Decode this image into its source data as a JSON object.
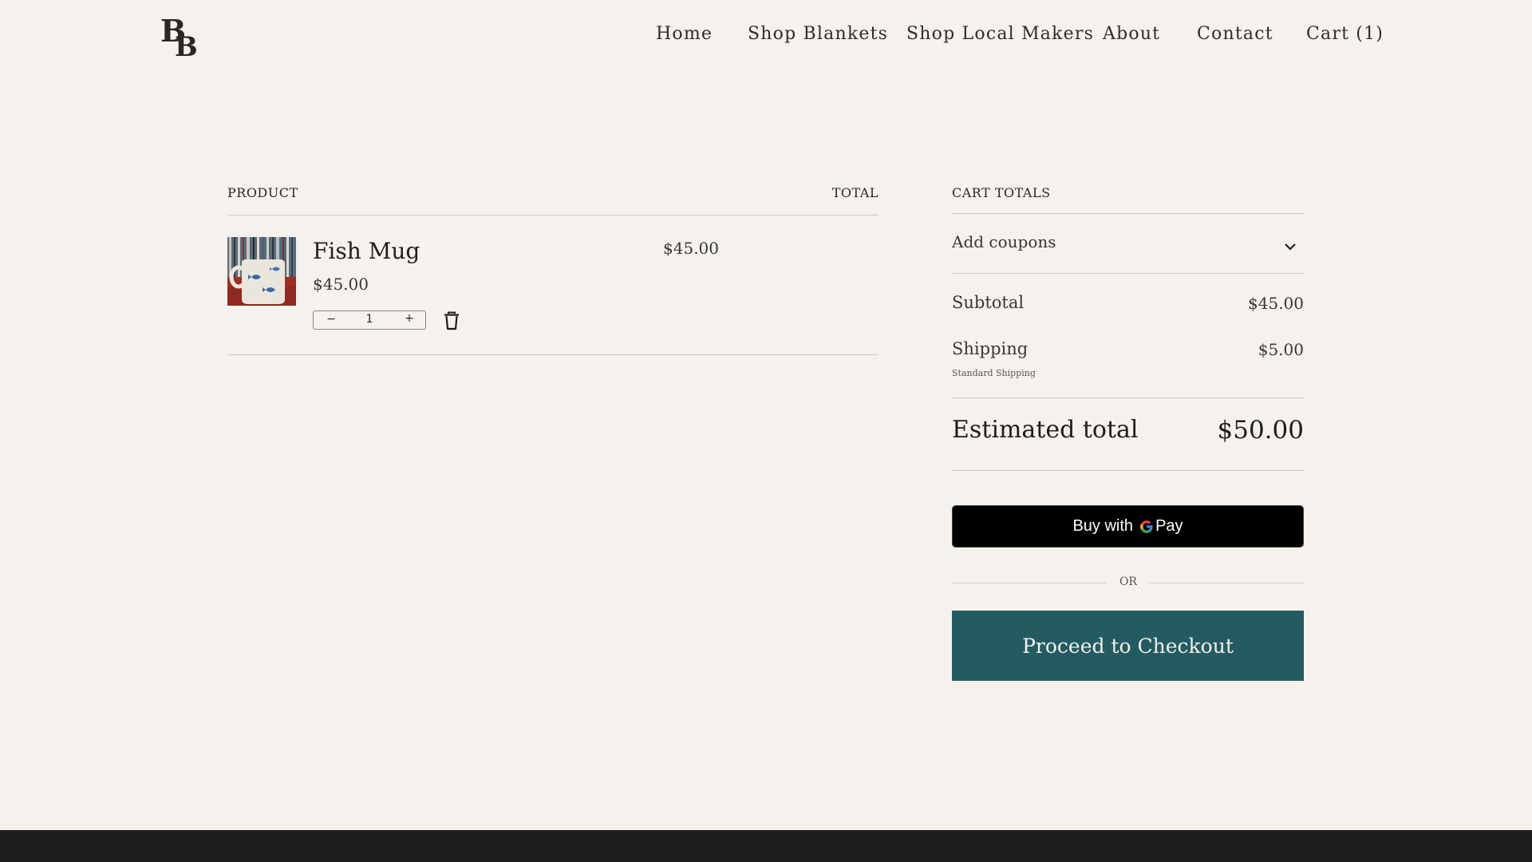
{
  "header": {
    "logo_text": "BB",
    "nav": {
      "home": "Home",
      "shop_blankets": "Shop Blankets",
      "shop_local_makers": "Shop Local Makers",
      "about": "About",
      "contact": "Contact",
      "cart": "Cart (1)"
    }
  },
  "cart": {
    "columns": {
      "product": "PRODUCT",
      "total": "TOTAL"
    },
    "items": [
      {
        "name": "Fish Mug",
        "price": "$45.00",
        "quantity": "1",
        "line_total": "$45.00",
        "decrement_symbol": "−",
        "increment_symbol": "+"
      }
    ]
  },
  "totals": {
    "heading": "CART TOTALS",
    "coupons_label": "Add coupons",
    "subtotal_label": "Subtotal",
    "subtotal_value": "$45.00",
    "shipping_label": "Shipping",
    "shipping_value": "$5.00",
    "shipping_method": "Standard Shipping",
    "estimated_label": "Estimated total",
    "estimated_value": "$50.00",
    "gpay_prefix": "Buy with",
    "gpay_g": "G",
    "gpay_suffix": "Pay",
    "or_text": "OR",
    "checkout_label": "Proceed to Checkout"
  },
  "colors": {
    "background": "#f5f2ed",
    "accent": "#245b62",
    "footer": "#1e1e20"
  }
}
